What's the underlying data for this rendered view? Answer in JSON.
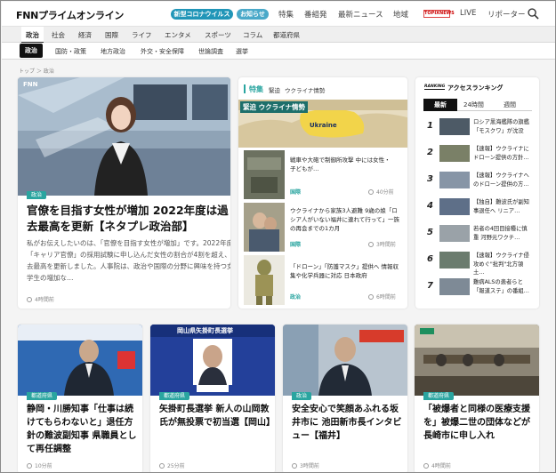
{
  "header": {
    "logo": "FNNプライムオンライン",
    "covid_pill": "新型コロナウイルス",
    "notice_pill": "お知らせ",
    "nav": [
      "特集",
      "番組発",
      "最新ニュース",
      "地域",
      "LIVE",
      "リポーター"
    ],
    "partner_logo": "TOPIXNEWS"
  },
  "categories": [
    "政治",
    "社会",
    "経済",
    "国際",
    "ライフ",
    "エンタメ",
    "スポーツ",
    "コラム",
    "都道府県"
  ],
  "active_category": "政治",
  "subcategories": [
    "政治",
    "国防・政策",
    "地方政治",
    "外交・安全保障",
    "世論調査",
    "選挙"
  ],
  "active_subcategory": "政治",
  "breadcrumb": "トップ ＞ 政治",
  "main_article": {
    "tag": "政治",
    "title": "官僚を目指す女性が増加 2022年度は過去最高を更新【ネタプレ政治部】",
    "lead": "私がお伝えしたいのは、「官僚を目指す女性が増加」です。2022年度の「キャリア官僚」の採用試験に申し込んだ女性の割合が4割を超え、過去最高を更新しました。人事院は、政治や国際の分野に興味を持つ女子学生の増加な…",
    "time": "4時間前",
    "image_label": "FNN"
  },
  "feature": {
    "label": "特集",
    "sub1": "緊迫",
    "sub2": "ウクライナ情勢",
    "banner": "緊迫 ウクライナ情勢",
    "map_label": "Ukraine",
    "items": [
      {
        "title": "戦車や大砲で制御所攻撃 中には女性・子どもが…",
        "tag": "国際",
        "time": "40分前"
      },
      {
        "title": "ウクライナから家族3人避難 9歳の娘「ロシア人がいない福井に連れて行って」一族の再会までの1カ月",
        "tag": "国際",
        "time": "3時間前"
      },
      {
        "title": "「ドローン」「防護マスク」提供へ 情報収集や化学兵器に対応 日本政府",
        "tag": "政治",
        "time": "6時間前"
      }
    ]
  },
  "ranking": {
    "badge": "RANKING",
    "title": "アクセスランキング",
    "tabs": [
      "最新",
      "24時間",
      "週間"
    ],
    "active_tab": "最新",
    "items": [
      {
        "rank": "1",
        "title": "ロシア黒海艦隊の旗艦「モスクワ」が沈没"
      },
      {
        "rank": "2",
        "title": "【速報】ウクライナにドローン提供の方針…"
      },
      {
        "rank": "3",
        "title": "【速報】ウクライナへのドローン提供の方…"
      },
      {
        "rank": "4",
        "title": "【独自】難波氏が副知事退任へ リニア…"
      },
      {
        "rank": "5",
        "title": "若者の4回目接種に慎重 河野元ワクチ…"
      },
      {
        "rank": "6",
        "title": "【速報】ウクライナ侵攻めぐ\"批判\"北方領土…"
      },
      {
        "rank": "7",
        "title": "難病ALSの患者らと「報道ステ」の番組…"
      }
    ]
  },
  "bottom_articles": [
    {
      "tag": "都道府県",
      "title": "静岡・川勝知事「仕事は続けてもらわないと」退任方針の難波副知事 県職員として再任調整",
      "time": "10分前"
    },
    {
      "tag": "都道府県",
      "title": "矢掛町長選挙 新人の山岡敦氏が無投票で初当選【岡山】",
      "time": "25分前",
      "image_banner": "岡山県矢掛町長選挙"
    },
    {
      "tag": "政治",
      "title": "安全安心で笑顔あふれる坂井市に 池田新市長インタビュー【福井】",
      "time": "3時間前"
    },
    {
      "tag": "都道府県",
      "title": "「被爆者と同様の医療支援を」被爆二世の団体などが長崎市に申し入れ",
      "time": "4時間前"
    }
  ],
  "colors": {
    "accent": "#2aa5a0",
    "covid": "#2196b8",
    "notice": "#4aa9c9"
  }
}
